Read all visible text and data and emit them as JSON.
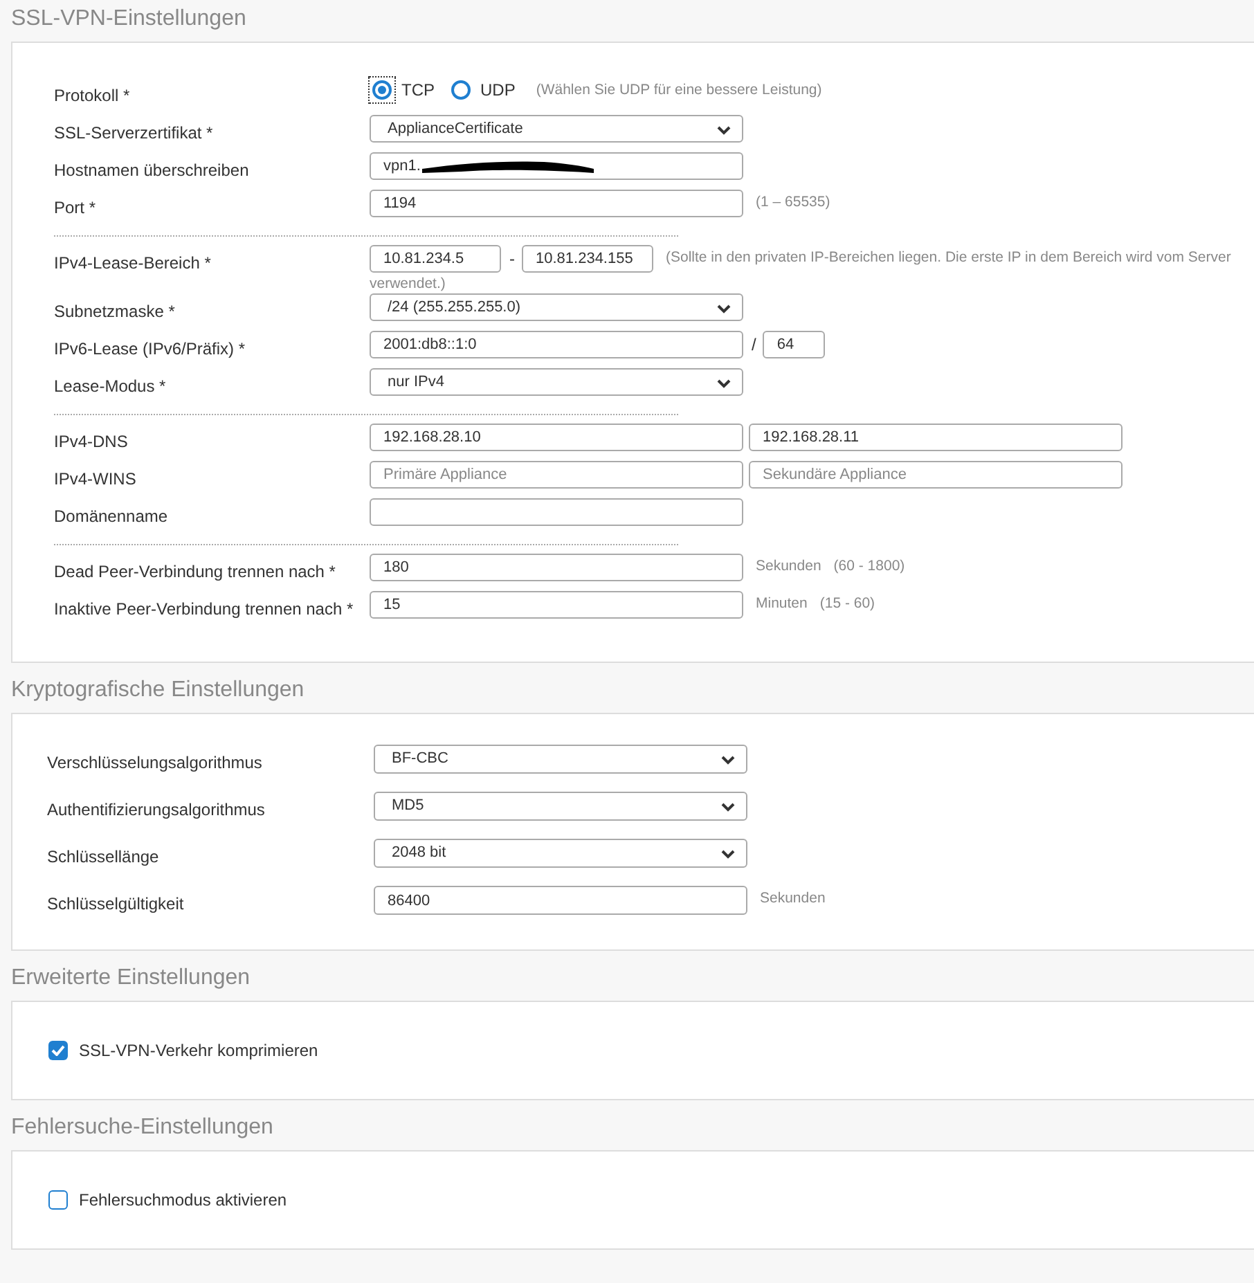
{
  "sections": [
    {
      "title": "SSL-VPN-Einstellungen",
      "kind": "dense",
      "rows": [
        {
          "kind": "field",
          "label": "Protokoll *",
          "controls": [
            {
              "kind": "radio",
              "label": "TCP",
              "selected": true
            },
            {
              "kind": "radio",
              "label": "UDP",
              "selected": false
            },
            {
              "kind": "hint",
              "text": "(Wählen Sie UDP für eine bessere Leistung)"
            }
          ]
        },
        {
          "kind": "field",
          "label": "SSL-Serverzertifikat *",
          "controls": [
            {
              "kind": "select",
              "value": "ApplianceCertificate"
            }
          ]
        },
        {
          "kind": "field",
          "label": "Hostnamen überschreiben",
          "controls": [
            {
              "kind": "input",
              "value": "vpn1.",
              "redacted": true
            }
          ]
        },
        {
          "kind": "field",
          "label": "Port *",
          "controls": [
            {
              "kind": "input",
              "value": "1194"
            },
            {
              "kind": "hint",
              "text": "(1 – 65535)"
            }
          ]
        },
        {
          "kind": "divider"
        },
        {
          "kind": "field",
          "label": "IPv4-Lease-Bereich *",
          "controls": [
            {
              "kind": "short-input",
              "value": "10.81.234.5"
            },
            {
              "kind": "separator",
              "text": "-"
            },
            {
              "kind": "short-input",
              "value": "10.81.234.155"
            },
            {
              "kind": "hint",
              "text": "(Sollte in den privaten IP-Bereichen liegen. Die erste IP in dem Bereich wird vom Server"
            },
            {
              "kind": "hint-line",
              "text": "verwendet.)"
            }
          ]
        },
        {
          "kind": "field",
          "label": "Subnetzmaske *",
          "controls": [
            {
              "kind": "select",
              "value": "/24 (255.255.255.0)"
            }
          ]
        },
        {
          "kind": "field",
          "label": "IPv6-Lease (IPv6/Präfix) *",
          "controls": [
            {
              "kind": "input",
              "value": "2001:db8::1:0"
            },
            {
              "kind": "separator",
              "text": "/"
            },
            {
              "kind": "tiny-input",
              "value": "64"
            }
          ]
        },
        {
          "kind": "field",
          "label": "Lease-Modus *",
          "controls": [
            {
              "kind": "select",
              "value": "nur IPv4"
            }
          ]
        },
        {
          "kind": "divider"
        },
        {
          "kind": "field",
          "label": "IPv4-DNS",
          "controls": [
            {
              "kind": "input",
              "value": "192.168.28.10"
            },
            {
              "kind": "input",
              "value": "192.168.28.11"
            }
          ]
        },
        {
          "kind": "field",
          "label": "IPv4-WINS",
          "controls": [
            {
              "kind": "input",
              "placeholder": "Primäre Appliance"
            },
            {
              "kind": "input",
              "placeholder": "Sekundäre Appliance"
            }
          ]
        },
        {
          "kind": "field",
          "label": "Domänenname",
          "controls": [
            {
              "kind": "input"
            }
          ]
        },
        {
          "kind": "divider"
        },
        {
          "kind": "field",
          "label": "Dead Peer-Verbindung trennen nach *",
          "controls": [
            {
              "kind": "input",
              "value": "180"
            },
            {
              "kind": "hint",
              "text": "Sekunden"
            },
            {
              "kind": "hint",
              "text": "(60 - 1800)"
            }
          ]
        },
        {
          "kind": "field",
          "label": "Inaktive Peer-Verbindung trennen nach *",
          "controls": [
            {
              "kind": "input",
              "value": "15"
            },
            {
              "kind": "hint",
              "text": "Minuten"
            },
            {
              "kind": "hint",
              "text": "(15 - 60)"
            }
          ]
        }
      ]
    },
    {
      "title": "Kryptografische Einstellungen",
      "kind": "spaced",
      "rows": [
        {
          "kind": "field",
          "label": "Verschlüsselungsalgorithmus",
          "controls": [
            {
              "kind": "select",
              "value": "BF-CBC"
            }
          ]
        },
        {
          "kind": "field",
          "label": "Authentifizierungsalgorithmus",
          "controls": [
            {
              "kind": "select",
              "value": "MD5"
            }
          ]
        },
        {
          "kind": "field",
          "label": "Schlüssellänge",
          "controls": [
            {
              "kind": "select",
              "value": "2048 bit"
            }
          ]
        },
        {
          "kind": "field",
          "label": "Schlüsselgültigkeit",
          "controls": [
            {
              "kind": "input",
              "value": "86400"
            },
            {
              "kind": "hint",
              "text": "Sekunden"
            }
          ]
        }
      ]
    },
    {
      "title": "Erweiterte Einstellungen",
      "kind": "spaced",
      "rows": [
        {
          "kind": "checkbox",
          "label": "SSL-VPN-Verkehr komprimieren",
          "checked": true
        }
      ]
    },
    {
      "title": "Fehlersuche-Einstellungen",
      "kind": "spaced",
      "rows": [
        {
          "kind": "checkbox",
          "label": "Fehlersuchmodus aktivieren",
          "checked": false
        }
      ]
    }
  ]
}
